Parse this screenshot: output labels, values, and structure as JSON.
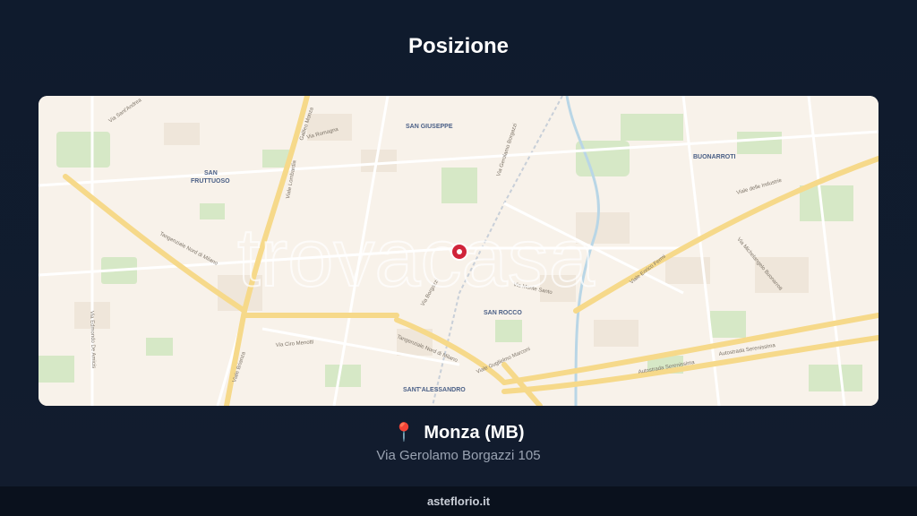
{
  "title": "Posizione",
  "map": {
    "watermark": "trovacasa",
    "marker": "map-pin-marker",
    "districts": {
      "san_giuseppe": "SAN GIUSEPPE",
      "san": "SAN",
      "fruttuoso": "FRUTTUOSO",
      "buonarroti": "BUONARROTI",
      "san_rocco": "SAN ROCCO",
      "sant_alessandro": "SANT'ALESSANDRO"
    },
    "streets": {
      "borgazzi": "Via Gerolamo Borgazzi",
      "borgazzi2": "Via Borgazzi",
      "industrie": "Viale delle Industrie",
      "fermi": "Viale Enrico Fermi",
      "tangenziale_nord": "Tangenziale Nord di Milano",
      "tangenziale_nord2": "Tangenziale Nord di Milano",
      "serenissima1": "Autostrada Serenissima",
      "serenissima2": "Autostrada Serenissima",
      "marconi": "Viale Guglielmo Marconi",
      "lombardia": "Viale Lombardia",
      "brianza": "Viale Brianza",
      "campania": "Galileo Monza",
      "de_amicis": "Via Edmondo De Amicis",
      "ciro_menotti": "Via Ciro Menotti",
      "michelangelo": "Via Michelangelo Buonarroti",
      "monte_santo": "Via Monte Santo",
      "romagna": "Via Romagna",
      "sant_andrea": "Via Sant'Andrea"
    }
  },
  "location": {
    "pin_icon": "pin-emoji-icon",
    "pin": "📍",
    "city": "Monza (MB)",
    "address": "Via Gerolamo Borgazzi 105"
  },
  "footer": {
    "brand": "asteflorio.it"
  },
  "colors": {
    "background": "#0f1b2d",
    "map_bg": "#f8f2ea",
    "road_major": "#f6d98a",
    "park": "#cfe6c0",
    "marker": "#d0243a"
  }
}
